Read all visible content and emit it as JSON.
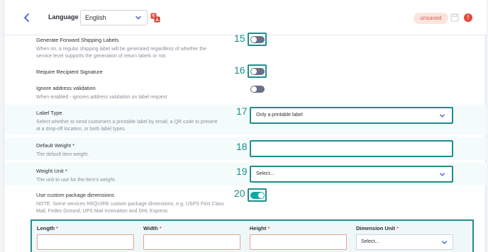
{
  "header": {
    "language_label": "Language",
    "language_value": "English",
    "status_badge": "unsaved",
    "alert_glyph": "!"
  },
  "fields": {
    "forward_labels": {
      "label": "Generate Forward Shipping Labels",
      "description_line1": "When on, a regular shipping label will be generated regardless of whether the",
      "description_line2": "service level supports the generation of return labels or not.",
      "marker": "15",
      "toggle_on": false
    },
    "recipient_signature": {
      "label": "Require Recipient Signature",
      "marker": "16",
      "toggle_on": false
    },
    "ignore_address": {
      "label": "Ignore address validation",
      "description": "When enabled - ignores address validation on label request",
      "toggle_on": false
    },
    "label_type": {
      "label": "Label Type",
      "description_line1": "Select whether to send customers a printable label by email, a QR code to present",
      "description_line2": "at a drop-off location, or both label types.",
      "marker": "17",
      "value": "Only a printable label"
    },
    "default_weight": {
      "label": "Default Weight *",
      "description": "The default item weight.",
      "marker": "18",
      "value": ""
    },
    "weight_unit": {
      "label": "Weight Unit *",
      "description": "The unit to use for the item's weight.",
      "marker": "19",
      "value": "Select..."
    },
    "custom_dimensions": {
      "label": "Use custom package dimensions",
      "description_line1": "NOTE: Some services REQUIRE custom package dimensions, e.g. USPS First Class",
      "description_line2": "Mail, Fedex Ground, UPS Mail Innovation and DHL Express",
      "marker": "20",
      "toggle_on": true
    }
  },
  "dimensions": {
    "length_label": "Length",
    "width_label": "Width",
    "height_label": "Height",
    "unit_label": "Dimension Unit",
    "required_mark": "*",
    "unit_value": "Select..."
  },
  "icons": {
    "back": "chevron-left-icon",
    "dropdown": "chevron-down-icon",
    "translate": "translate-icon",
    "save": "save-icon",
    "alert": "alert-icon"
  },
  "colors": {
    "accent": "#3f5bd6",
    "highlight": "#1f8e8d",
    "toggle_on": "#0fa9a2",
    "toggle_off": "#6b6f85",
    "badge_bg": "#fde4df",
    "badge_text": "#d9614a",
    "alert": "#e5483a"
  }
}
